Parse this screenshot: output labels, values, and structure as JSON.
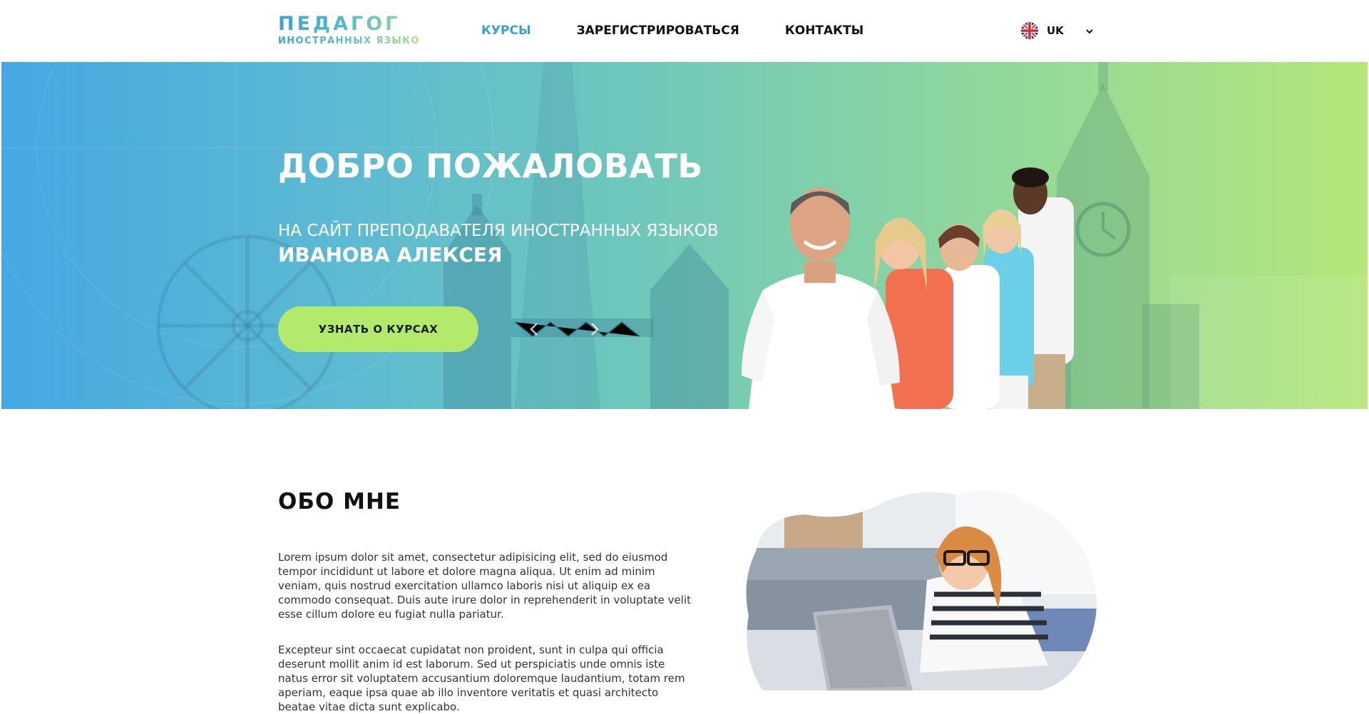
{
  "header": {
    "logo_title": "ПЕДАГОГ",
    "logo_subtitle": "ИНОСТРАННЫХ  ЯЗЫКОВ",
    "nav": [
      {
        "label": "КУРСЫ",
        "active": true
      },
      {
        "label": "ЗАРЕГИСТРИРОВАТЬСЯ",
        "active": false
      },
      {
        "label": "КОНТАКТЫ",
        "active": false
      }
    ],
    "language": {
      "label": "UK",
      "flag_icon": "uk-flag-icon",
      "dropdown_icon": "chevron-down-icon"
    }
  },
  "hero": {
    "title": "ДОБРО ПОЖАЛОВАТЬ",
    "subtitle": "НА САЙТ ПРЕПОДАВАТЕЛЯ ИНОСТРАННЫХ ЯЗЫКОВ",
    "name": "ИВАНОВА АЛЕКСЕЯ",
    "cta_label": "УЗНАТЬ О КУРСАХ",
    "prev_icon": "chevron-left-icon",
    "next_icon": "chevron-right-icon"
  },
  "about": {
    "title": "ОБО МНЕ",
    "paragraphs": [
      "Lorem ipsum dolor sit amet, consectetur adipisicing elit, sed do eiusmod tempor incididunt ut labore et dolore magna aliqua. Ut enim ad minim veniam, quis nostrud exercitation ullamco laboris nisi ut aliquip ex ea commodo consequat. Duis aute irure dolor in reprehenderit in voluptate velit esse cillum dolore eu fugiat nulla pariatur.",
      "Excepteur sint occaecat cupidatat non proident, sunt in culpa qui officia deserunt mollit anim id est laborum. Sed ut perspiciatis unde omnis iste natus error sit voluptatem accusantium doloremque laudantium, totam rem aperiam, eaque ipsa quae ab illo inventore veritatis et quasi architecto beatae vitae dicta sunt explicabo."
    ]
  },
  "colors": {
    "accent_blue": "#3ba0d8",
    "cta_green": "#b3ea6c",
    "hero_gradient_start": "#45a8e2",
    "hero_gradient_end": "#b4e77a"
  }
}
